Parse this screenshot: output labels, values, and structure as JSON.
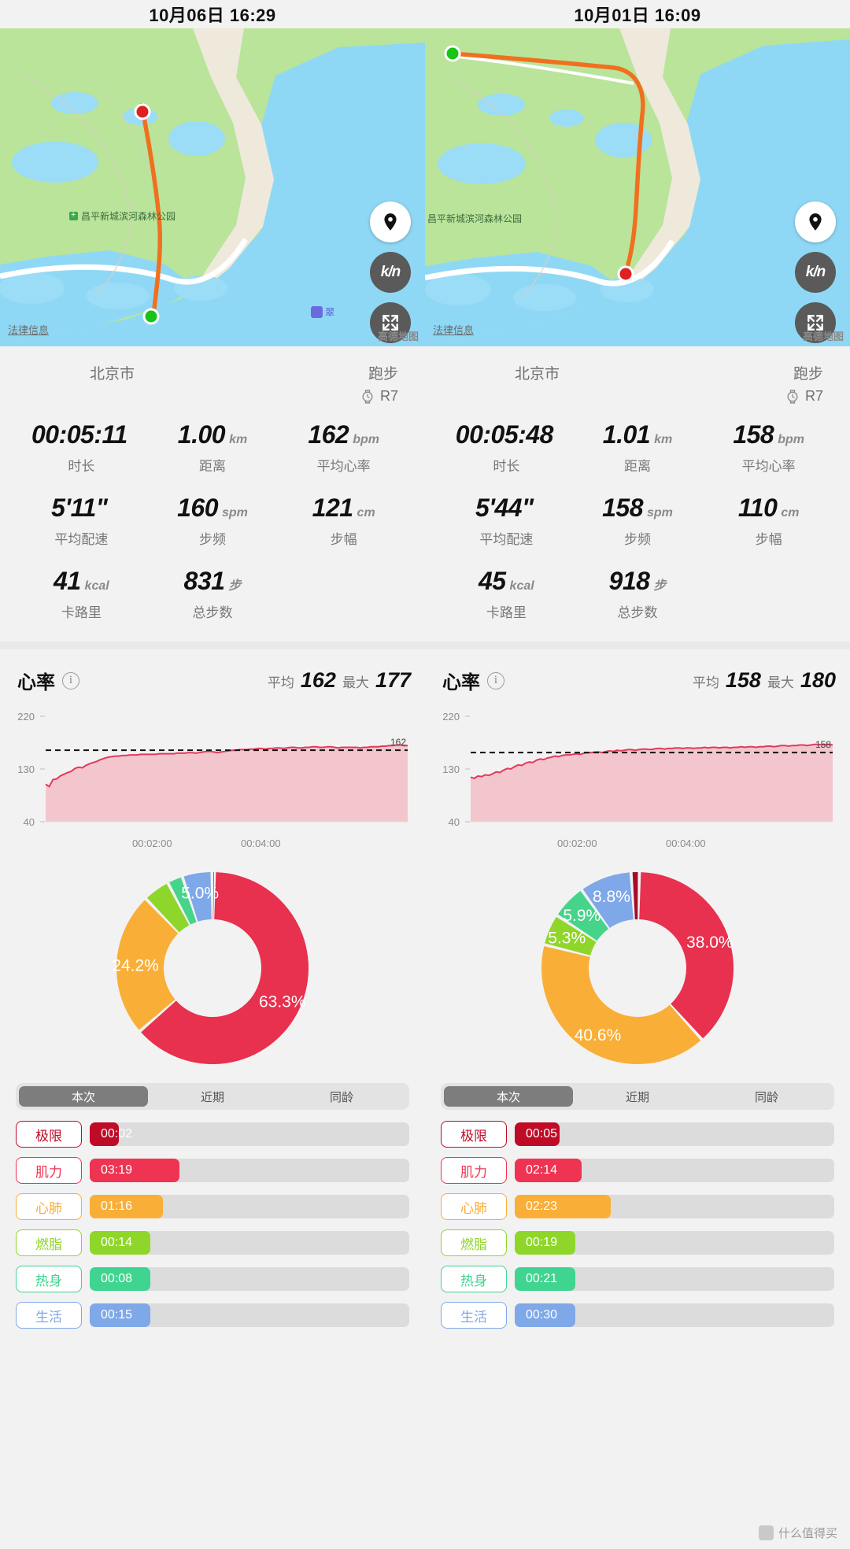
{
  "sessions": [
    {
      "header_date": "10月06日 16:29",
      "map": {
        "legal_label": "法律信息",
        "provider_label": "高德地图",
        "poi_label": "昌平新城滨河森林公园",
        "poi2_label": "翠",
        "locate_icon": "location-pin-icon",
        "speed_icon": "km-unit-icon",
        "fullscreen_icon": "expand-icon",
        "start_marker": "green-start-marker",
        "end_marker": "red-end-marker",
        "route_color": "#f07020"
      },
      "city": "北京市",
      "activity": "跑步",
      "device": "R7",
      "device_icon": "watch-icon",
      "metrics": [
        {
          "value": "00:05:11",
          "unit": "",
          "label": "时长"
        },
        {
          "value": "1.00",
          "unit": "km",
          "label": "距离"
        },
        {
          "value": "162",
          "unit": "bpm",
          "label": "平均心率"
        },
        {
          "value": "5'11\"",
          "unit": "",
          "label": "平均配速"
        },
        {
          "value": "160",
          "unit": "spm",
          "label": "步频"
        },
        {
          "value": "121",
          "unit": "cm",
          "label": "步幅"
        },
        {
          "value": "41",
          "unit": "kcal",
          "label": "卡路里"
        },
        {
          "value": "831",
          "unit": "步",
          "label": "总步数"
        }
      ],
      "heart_rate": {
        "title": "心率",
        "info_icon": "info-icon",
        "avg_label": "平均",
        "avg_value": "162",
        "max_label": "最大",
        "max_value": "177",
        "avg_line_label": "162",
        "chart": {
          "type": "area",
          "ylim": [
            40,
            220
          ],
          "yticks": [
            220,
            130,
            40
          ],
          "xticks": [
            "00:02:00",
            "00:04:00"
          ],
          "avg_line": 162,
          "line_color": "#e23a5a",
          "fill_color": "#f3c6ce",
          "series": [
            {
              "name": "心率",
              "values": [
                104,
                100,
                112,
                113,
                118,
                121,
                124,
                126,
                131,
                133,
                132,
                136,
                139,
                141,
                143,
                146,
                148,
                150,
                151,
                152,
                152,
                153,
                153,
                154,
                154,
                154,
                155,
                155,
                155,
                155,
                155,
                156,
                156,
                156,
                156,
                156,
                157,
                157,
                157,
                158,
                158,
                157,
                158,
                159,
                160,
                160,
                159,
                158,
                159,
                160,
                161,
                162,
                162,
                163,
                163,
                163,
                164,
                164,
                165,
                165,
                164,
                165,
                165,
                166,
                166,
                165,
                166,
                167,
                167,
                166,
                166,
                167,
                167,
                168,
                168,
                167,
                167,
                168,
                168,
                167,
                166,
                167,
                167,
                167,
                167,
                167,
                166,
                167,
                167,
                168,
                168,
                168,
                169,
                169,
                170,
                170,
                171,
                171,
                170,
                170
              ]
            }
          ]
        }
      },
      "donut": {
        "type": "pie",
        "title": "",
        "slices": [
          {
            "label": "肌力",
            "percent": 63.3,
            "color": "#e8304f",
            "show_label": true
          },
          {
            "label": "心肺",
            "percent": 24.2,
            "color": "#f9ae38",
            "show_label": true
          },
          {
            "label": "燃脂",
            "percent": 4.5,
            "color": "#8fd62a",
            "show_label": false
          },
          {
            "label": "热身",
            "percent": 2.6,
            "color": "#45d48a",
            "show_label": false
          },
          {
            "label": "生活",
            "percent": 5.0,
            "color": "#7fa8e8",
            "show_label": true
          },
          {
            "label": "极限",
            "percent": 0.6,
            "color": "#a50c28",
            "show_label": false
          }
        ],
        "labels": [
          "63.3%",
          "24.2%",
          "5.0%"
        ]
      },
      "tabs": [
        {
          "label": "本次",
          "active": true
        },
        {
          "label": "近期",
          "active": false
        },
        {
          "label": "同龄",
          "active": false
        }
      ],
      "zones": [
        {
          "name": "极限",
          "time": "00:02",
          "color": "#bf0b26",
          "pct": 9
        },
        {
          "name": "肌力",
          "time": "03:19",
          "color": "#ef3352",
          "pct": 28
        },
        {
          "name": "心肺",
          "time": "01:16",
          "color": "#f9ae38",
          "pct": 23
        },
        {
          "name": "燃脂",
          "time": "00:14",
          "color": "#8fd62a",
          "pct": 19
        },
        {
          "name": "热身",
          "time": "00:08",
          "color": "#3fd490",
          "pct": 19
        },
        {
          "name": "生活",
          "time": "00:15",
          "color": "#7fa8e8",
          "pct": 19
        }
      ]
    },
    {
      "header_date": "10月01日 16:09",
      "map": {
        "legal_label": "法律信息",
        "provider_label": "高德地图",
        "poi_label": "昌平新城滨河森林公园",
        "poi2_label": "",
        "locate_icon": "location-pin-icon",
        "speed_icon": "km-unit-icon",
        "fullscreen_icon": "expand-icon",
        "start_marker": "green-start-marker",
        "end_marker": "red-end-marker",
        "route_color": "#f07020"
      },
      "city": "北京市",
      "activity": "跑步",
      "device": "R7",
      "device_icon": "watch-icon",
      "metrics": [
        {
          "value": "00:05:48",
          "unit": "",
          "label": "时长"
        },
        {
          "value": "1.01",
          "unit": "km",
          "label": "距离"
        },
        {
          "value": "158",
          "unit": "bpm",
          "label": "平均心率"
        },
        {
          "value": "5'44\"",
          "unit": "",
          "label": "平均配速"
        },
        {
          "value": "158",
          "unit": "spm",
          "label": "步频"
        },
        {
          "value": "110",
          "unit": "cm",
          "label": "步幅"
        },
        {
          "value": "45",
          "unit": "kcal",
          "label": "卡路里"
        },
        {
          "value": "918",
          "unit": "步",
          "label": "总步数"
        }
      ],
      "heart_rate": {
        "title": "心率",
        "info_icon": "info-icon",
        "avg_label": "平均",
        "avg_value": "158",
        "max_label": "最大",
        "max_value": "180",
        "avg_line_label": "158",
        "chart": {
          "type": "area",
          "ylim": [
            40,
            220
          ],
          "yticks": [
            220,
            130,
            40
          ],
          "xticks": [
            "00:02:00",
            "00:04:00"
          ],
          "avg_line": 158,
          "line_color": "#e23a5a",
          "fill_color": "#f3c6ce",
          "series": [
            {
              "name": "心率",
              "values": [
                116,
                114,
                118,
                117,
                120,
                119,
                122,
                125,
                124,
                128,
                131,
                130,
                134,
                137,
                136,
                140,
                142,
                141,
                145,
                147,
                146,
                149,
                150,
                152,
                151,
                153,
                154,
                154,
                155,
                156,
                155,
                157,
                158,
                158,
                159,
                159,
                158,
                160,
                161,
                160,
                162,
                161,
                162,
                163,
                163,
                162,
                163,
                164,
                164,
                163,
                164,
                165,
                165,
                164,
                165,
                165,
                166,
                166,
                165,
                166,
                166,
                165,
                166,
                166,
                167,
                166,
                167,
                167,
                166,
                167,
                167,
                166,
                167,
                167,
                168,
                167,
                168,
                168,
                167,
                168,
                168,
                169,
                169,
                168,
                169,
                170,
                170,
                169,
                170,
                170,
                171,
                171,
                170,
                171,
                172,
                172,
                171,
                172,
                172,
                171
              ]
            }
          ]
        }
      },
      "donut": {
        "type": "pie",
        "title": "",
        "slices": [
          {
            "label": "肌力",
            "percent": 38.0,
            "color": "#e8304f",
            "show_label": true
          },
          {
            "label": "心肺",
            "percent": 40.6,
            "color": "#f9ae38",
            "show_label": true
          },
          {
            "label": "燃脂",
            "percent": 5.3,
            "color": "#8fd62a",
            "show_label": true
          },
          {
            "label": "热身",
            "percent": 5.9,
            "color": "#45d48a",
            "show_label": true
          },
          {
            "label": "生活",
            "percent": 8.8,
            "color": "#7fa8e8",
            "show_label": true
          },
          {
            "label": "极限",
            "percent": 1.4,
            "color": "#a50c28",
            "show_label": false
          }
        ],
        "labels": [
          "38.0%",
          "40.6%",
          "5.3%",
          "5.9%",
          "8.8%"
        ]
      },
      "tabs": [
        {
          "label": "本次",
          "active": true
        },
        {
          "label": "近期",
          "active": false
        },
        {
          "label": "同龄",
          "active": false
        }
      ],
      "zones": [
        {
          "name": "极限",
          "time": "00:05",
          "color": "#bf0b26",
          "pct": 14
        },
        {
          "name": "肌力",
          "time": "02:14",
          "color": "#ef3352",
          "pct": 21
        },
        {
          "name": "心肺",
          "time": "02:23",
          "color": "#f9ae38",
          "pct": 30
        },
        {
          "name": "燃脂",
          "time": "00:19",
          "color": "#8fd62a",
          "pct": 19
        },
        {
          "name": "热身",
          "time": "00:21",
          "color": "#3fd490",
          "pct": 19
        },
        {
          "name": "生活",
          "time": "00:30",
          "color": "#7fa8e8",
          "pct": 19
        }
      ]
    }
  ],
  "watermark": "什么值得买"
}
